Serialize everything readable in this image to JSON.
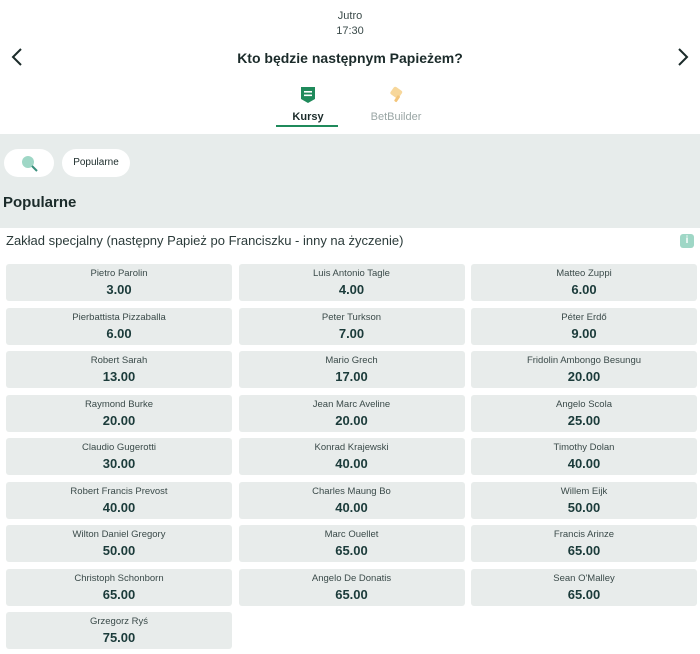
{
  "event": {
    "date": "Jutro",
    "time": "17:30",
    "title": "Kto będzie następnym Papieżem?"
  },
  "tabs": [
    {
      "label": "Kursy",
      "active": true
    },
    {
      "label": "BetBuilder",
      "active": false
    }
  ],
  "filters": {
    "active_filter": "Popularne"
  },
  "section_title": "Popularne",
  "market": {
    "name": "Zakład specjalny (następny Papież po Franciszku - inny na życzenie)",
    "info_label": "i",
    "selections": [
      {
        "name": "Pietro Parolin",
        "odds": "3.00"
      },
      {
        "name": "Luis Antonio Tagle",
        "odds": "4.00"
      },
      {
        "name": "Matteo Zuppi",
        "odds": "6.00"
      },
      {
        "name": "Pierbattista Pizzaballa",
        "odds": "6.00"
      },
      {
        "name": "Peter Turkson",
        "odds": "7.00"
      },
      {
        "name": "Péter Erdő",
        "odds": "9.00"
      },
      {
        "name": "Robert Sarah",
        "odds": "13.00"
      },
      {
        "name": "Mario Grech",
        "odds": "17.00"
      },
      {
        "name": "Fridolin Ambongo Besungu",
        "odds": "20.00"
      },
      {
        "name": "Raymond Burke",
        "odds": "20.00"
      },
      {
        "name": "Jean Marc Aveline",
        "odds": "20.00"
      },
      {
        "name": "Angelo Scola",
        "odds": "25.00"
      },
      {
        "name": "Claudio Gugerotti",
        "odds": "30.00"
      },
      {
        "name": "Konrad Krajewski",
        "odds": "40.00"
      },
      {
        "name": "Timothy Dolan",
        "odds": "40.00"
      },
      {
        "name": "Robert Francis Prevost",
        "odds": "40.00"
      },
      {
        "name": "Charles Maung Bo",
        "odds": "40.00"
      },
      {
        "name": "Willem Eijk",
        "odds": "50.00"
      },
      {
        "name": "Wilton Daniel Gregory",
        "odds": "50.00"
      },
      {
        "name": "Marc Ouellet",
        "odds": "65.00"
      },
      {
        "name": "Francis Arinze",
        "odds": "65.00"
      },
      {
        "name": "Christoph Schonborn",
        "odds": "65.00"
      },
      {
        "name": "Angelo De Donatis",
        "odds": "65.00"
      },
      {
        "name": "Sean O'Malley",
        "odds": "65.00"
      },
      {
        "name": "Grzegorz Ryś",
        "odds": "75.00"
      }
    ]
  },
  "colors": {
    "accent": "#1f8a5b",
    "page_bg": "#e7eceb",
    "odds_bg": "#e8eceb",
    "info_badge": "#9fd7c6"
  },
  "icons": {
    "prev": "chevron-left-icon",
    "next": "chevron-right-icon",
    "kursy": "odds-list-icon",
    "betbuilder": "betbuilder-icon",
    "search": "search-icon"
  }
}
